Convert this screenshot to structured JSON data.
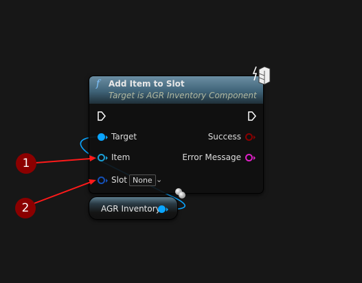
{
  "node": {
    "title": "Add Item to Slot",
    "subtitle": "Target is AGR Inventory Component",
    "function_icon": "f",
    "inputs": [
      {
        "label": "Target",
        "color": "#0aa5ff"
      },
      {
        "label": "Item",
        "color": "#1a9fd6"
      },
      {
        "label": "Slot",
        "color": "#1550b8",
        "value": "None"
      }
    ],
    "outputs": [
      {
        "label": "Success",
        "color": "#8a0000"
      },
      {
        "label": "Error Message",
        "color": "#e020c8"
      }
    ]
  },
  "variable_node": {
    "label": "AGR Inventory",
    "color": "#0aa5ff"
  },
  "markers": [
    {
      "label": "1"
    },
    {
      "label": "2"
    }
  ],
  "colors": {
    "marker": "#8b0000",
    "arrow": "#ff1a1a",
    "wire": "#0aa5ff"
  }
}
